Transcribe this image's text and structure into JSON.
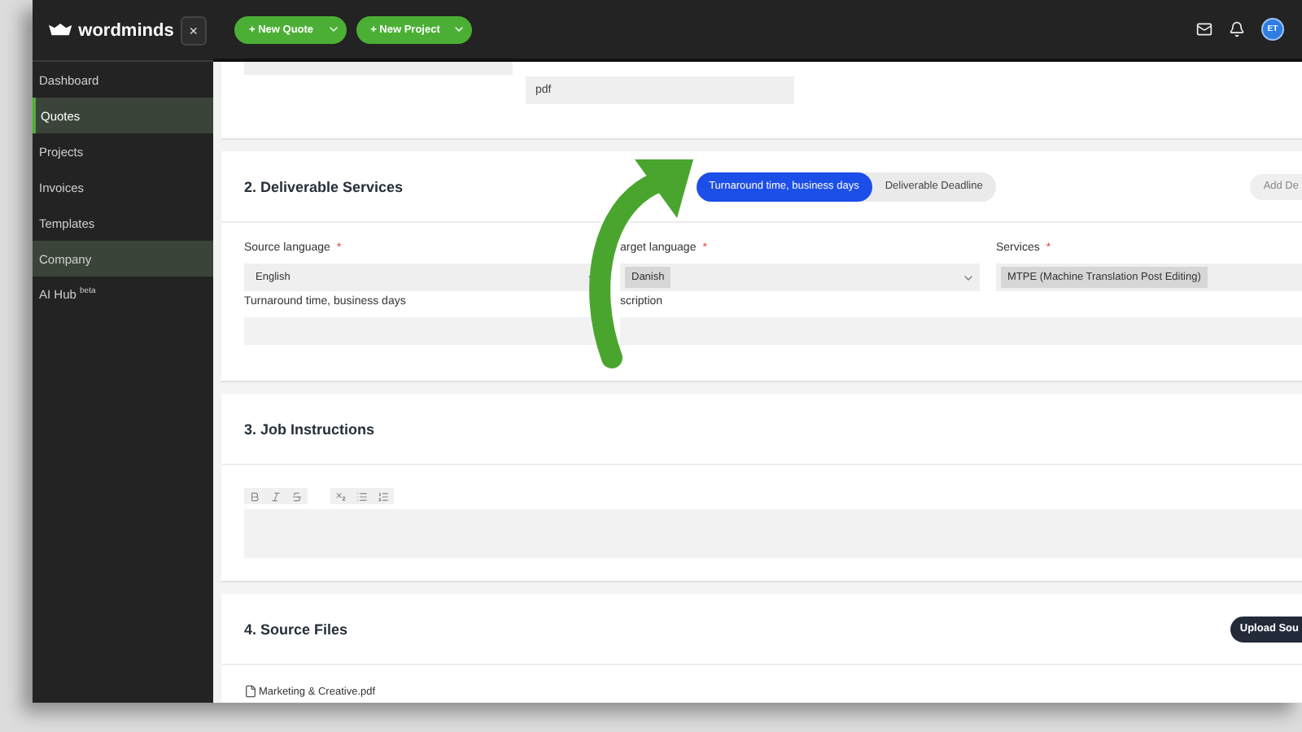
{
  "header": {
    "logo": "wordminds",
    "close_button": "×",
    "buttons": [
      {
        "label": "+ New Quote"
      },
      {
        "label": "+ New Project"
      }
    ],
    "avatar": "ET"
  },
  "sidebar": {
    "items": [
      {
        "label": "Dashboard",
        "selected": false,
        "highlighted": false
      },
      {
        "label": "Quotes",
        "selected": true,
        "highlighted": true
      },
      {
        "label": "Projects",
        "selected": false,
        "highlighted": false
      },
      {
        "label": "Invoices",
        "selected": false,
        "highlighted": false
      },
      {
        "label": "Templates",
        "selected": false,
        "highlighted": false
      },
      {
        "label": "Company",
        "selected": false,
        "highlighted": true
      },
      {
        "label": "AI Hub $^{beta}$",
        "selected": false,
        "highlighted": false
      }
    ]
  },
  "top_card": {
    "format_value": "pdf"
  },
  "deliverable": {
    "title": "2. Deliverable Services",
    "toggle": [
      {
        "label": "Turnaround time, business days",
        "selected": true
      },
      {
        "label": "Deliverable Deadline",
        "selected": false
      }
    ],
    "add_button": "Add De",
    "fields": [
      {
        "kind": "select",
        "label": "Source language",
        "required_mark": "*",
        "value": "English"
      },
      {
        "kind": "select-chip",
        "label": "arget language",
        "required_mark": "*",
        "value": "Danish"
      },
      {
        "kind": "chip",
        "label": "Services",
        "required_mark": "*",
        "value": "MTPE (Machine Translation Post Editing)"
      },
      {
        "kind": "input",
        "label": "Turnaround time, business days"
      },
      {
        "kind": "input",
        "label": "scription",
        "wide": true
      }
    ]
  },
  "instructions": {
    "title": "3. Job Instructions"
  },
  "source_files": {
    "title": "4. Source Files",
    "upload_button": "Upload Sou",
    "files": [
      {
        "name": "Marketing & Creative.pdf"
      }
    ]
  }
}
